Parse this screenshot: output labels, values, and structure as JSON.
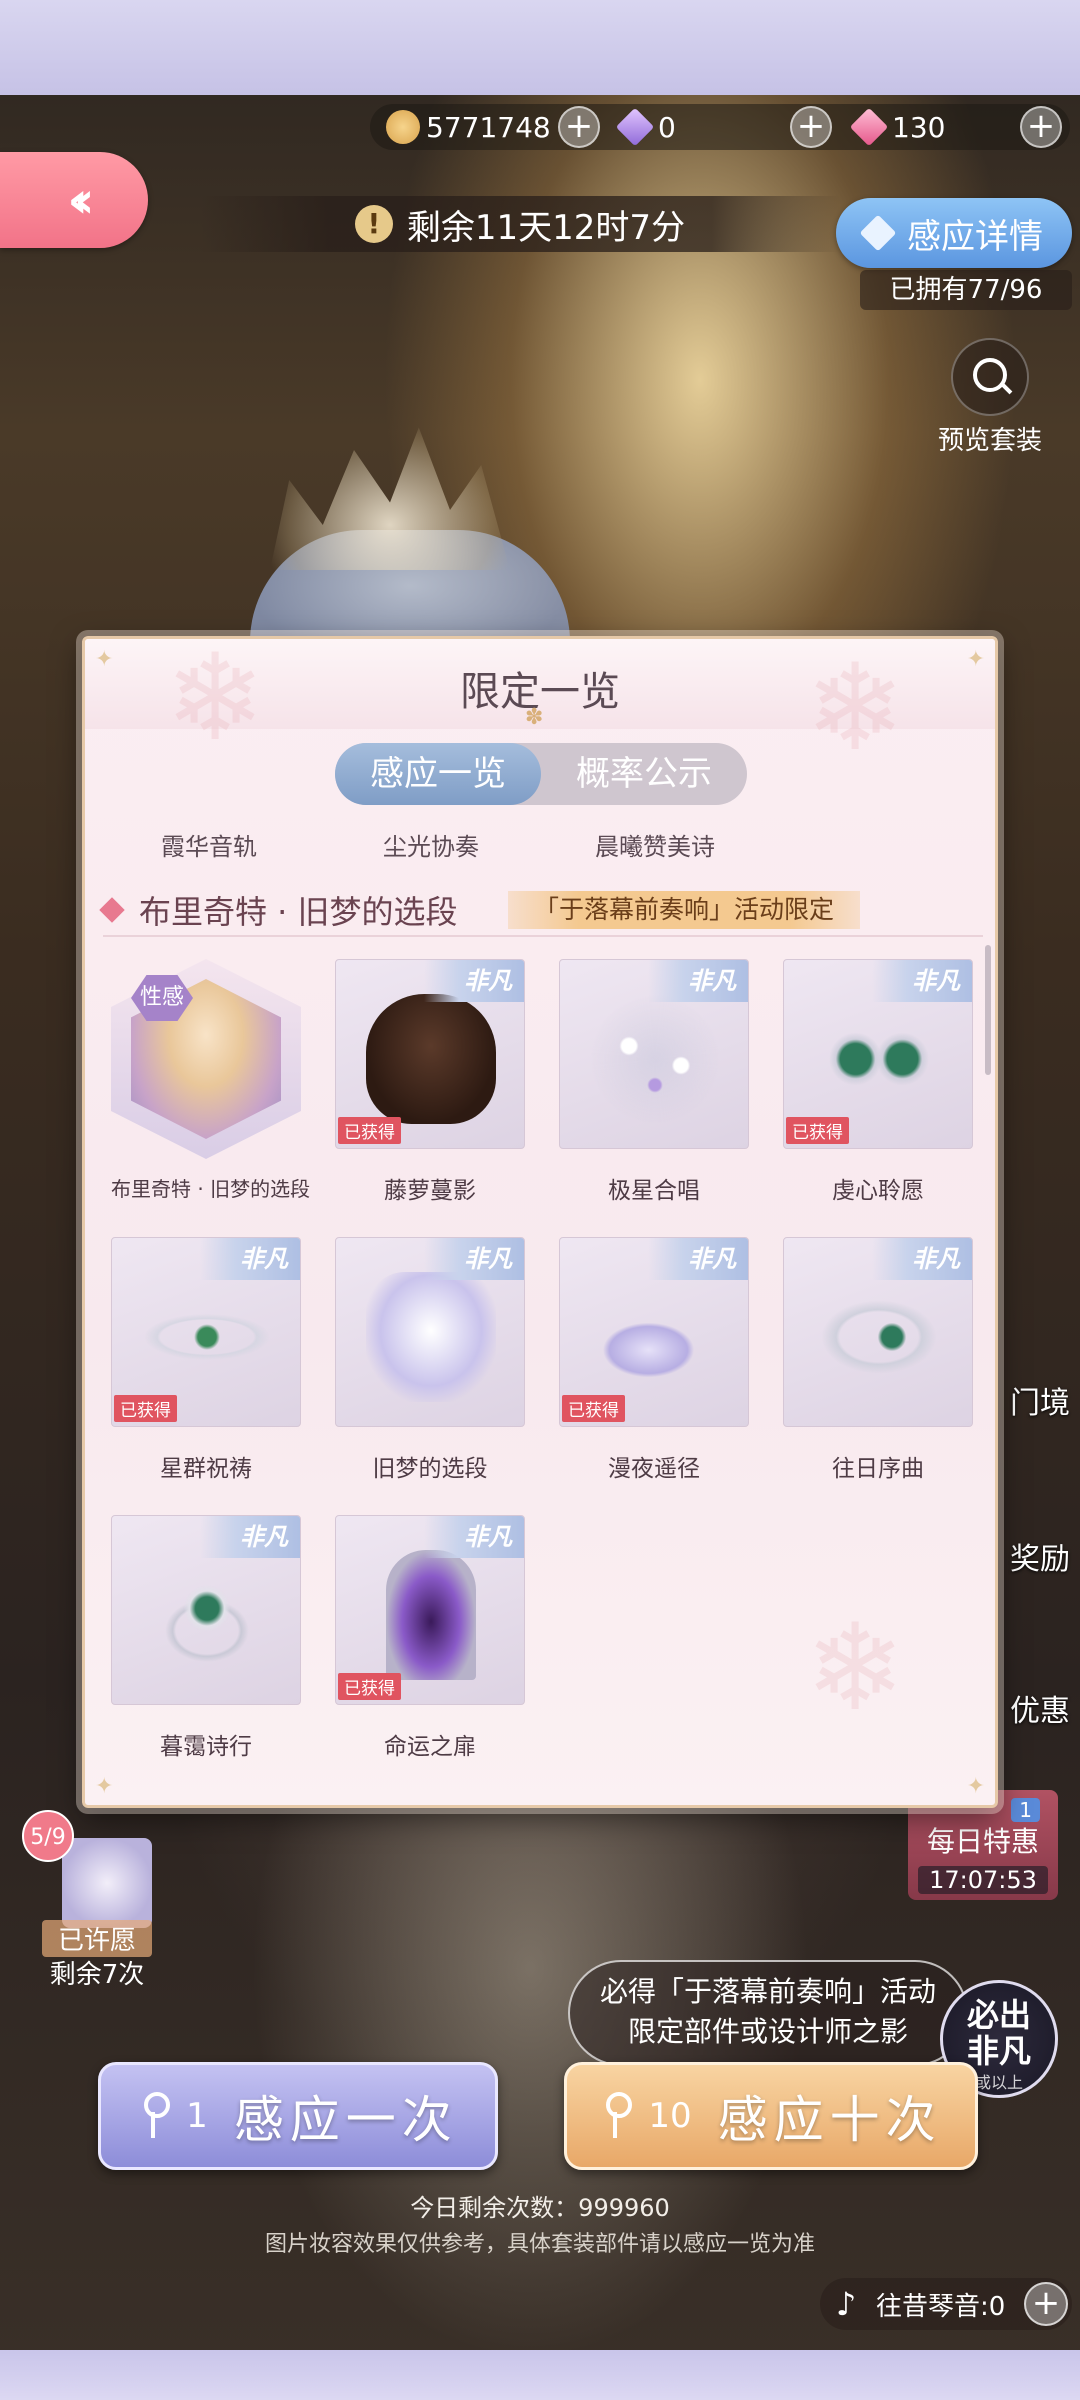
{
  "currency": {
    "gold": "5771748",
    "diamond": "0",
    "pink_diamond": "130"
  },
  "timer": {
    "text": "剩余11天12时7分"
  },
  "detail_button": {
    "label": "感应详情"
  },
  "owned_count": "已拥有77/96",
  "preview": {
    "label": "预览套装"
  },
  "side": {
    "item1": "门境",
    "item2": "奖励",
    "item3": "优惠"
  },
  "daily": {
    "label": "每日特惠",
    "time": "17:07:53",
    "badge": "1"
  },
  "modal": {
    "title": "限定一览",
    "tabs": [
      {
        "label": "感应一览"
      },
      {
        "label": "概率公示"
      }
    ],
    "subtabs": [
      "霞华音轨",
      "尘光协奏",
      "晨曦赞美诗"
    ],
    "section_title": "布里奇特 · 旧梦的选段",
    "limited_tag": "「于落幕前奏响」活动限定",
    "tier_label": "非凡",
    "owned_label": "已获得",
    "trait_label": "性感",
    "items": [
      {
        "name": "布里奇特 · 旧梦的选段",
        "owned": false
      },
      {
        "name": "藤萝蔓影",
        "owned": true
      },
      {
        "name": "极星合唱",
        "owned": false
      },
      {
        "name": "虔心聆愿",
        "owned": true
      },
      {
        "name": "星群祝祷",
        "owned": true
      },
      {
        "name": "旧梦的选段",
        "owned": false
      },
      {
        "name": "漫夜遥径",
        "owned": true
      },
      {
        "name": "往日序曲",
        "owned": false
      },
      {
        "name": "暮霭诗行",
        "owned": false
      },
      {
        "name": "命运之扉",
        "owned": true
      }
    ]
  },
  "wish": {
    "count": "5/9",
    "status": "已许愿",
    "remaining": "剩余7次"
  },
  "guarantee": {
    "line1": "必得「于落幕前奏响」活动",
    "line2": "限定部件或设计师之影"
  },
  "seal": {
    "line1": "必出",
    "line2": "非凡",
    "line3": "或以上"
  },
  "draw_one": {
    "count": "1",
    "label": "感应一次"
  },
  "draw_ten": {
    "count": "10",
    "label": "感应十次"
  },
  "remaining_today": "今日剩余次数：999960",
  "disclaimer": "图片妆容效果仅供参考，具体套装部件请以感应一览为准",
  "music": {
    "label": "往昔琴音:0"
  },
  "colors": {
    "accent_pink": "#f27388",
    "accent_blue": "#7f9dc6",
    "owned_red": "#e05460",
    "gold": "#e8a868"
  }
}
